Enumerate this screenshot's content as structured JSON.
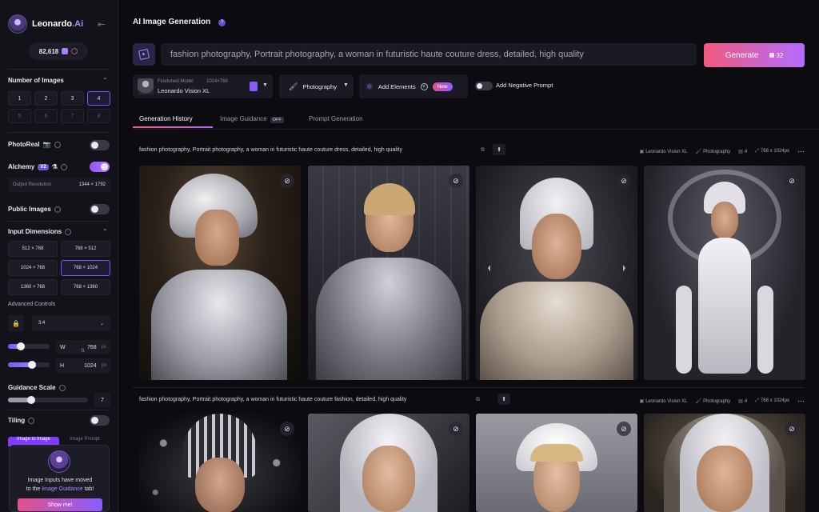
{
  "brand": {
    "name": "Leonardo",
    "suffix": ".Ai"
  },
  "tokens": "82,618",
  "sidebar": {
    "num_images_title": "Number of Images",
    "num_options": [
      "1",
      "2",
      "3",
      "4",
      "5",
      "6",
      "7",
      "8"
    ],
    "photoreal": "PhotoReal",
    "alchemy": "Alchemy",
    "alchemy_badge": "V2",
    "output_resolution_label": "Output Resolution",
    "output_resolution_value": "1344 × 1792",
    "public_images": "Public Images",
    "input_dimensions_title": "Input Dimensions",
    "dimensions": [
      "512 × 768",
      "768 × 512",
      "1024 × 768",
      "768 × 1024",
      "1360 × 768",
      "768 × 1360"
    ],
    "advanced_controls": "Advanced Controls",
    "aspect_ratio": "3:4",
    "width_label": "W",
    "width_value": "768",
    "height_label": "H",
    "height_value": "1024",
    "px": "px",
    "guidance_scale_title": "Guidance Scale",
    "guidance_scale_value": "7",
    "tiling": "Tiling",
    "mini_tabs": [
      "Image to Image",
      "Image Prompt"
    ],
    "popup_line1": "Image Inputs have moved",
    "popup_line2_pre": "to the ",
    "popup_link": "Image Guidance",
    "popup_line2_post": " tab!",
    "popup_button": "Show me!"
  },
  "main": {
    "title": "AI Image Generation",
    "prompt": "fashion photography, Portrait photography, a woman in futuristic haute couture dress, detailed, high quality",
    "generate_label": "Generate",
    "generate_cost": "32",
    "model_sub": "Finetuned Model",
    "model_res": "1024×768",
    "model_name": "Leonardo Vision XL",
    "style": "Photography",
    "add_elements": "Add Elements",
    "new_badge": "New",
    "negative_prompt": "Add Negative Prompt",
    "tabs": [
      "Generation History",
      "Image Guidance",
      "Prompt Generation"
    ],
    "off_badge": "OFF"
  },
  "generations": [
    {
      "prompt": "fashion photography, Portrait photography, a woman in futuristic haute couture dress, detailed, high quality",
      "model": "Leonardo Vision XL",
      "style": "Photography",
      "count": "4",
      "size": "768 x 1024px"
    },
    {
      "prompt": "fashion photography, Portrait photography, a woman in futuristic haute couture fashion, detailed, high quality",
      "model": "Leonardo Vision XL",
      "style": "Photography",
      "count": "4",
      "size": "768 x 1024px"
    }
  ]
}
